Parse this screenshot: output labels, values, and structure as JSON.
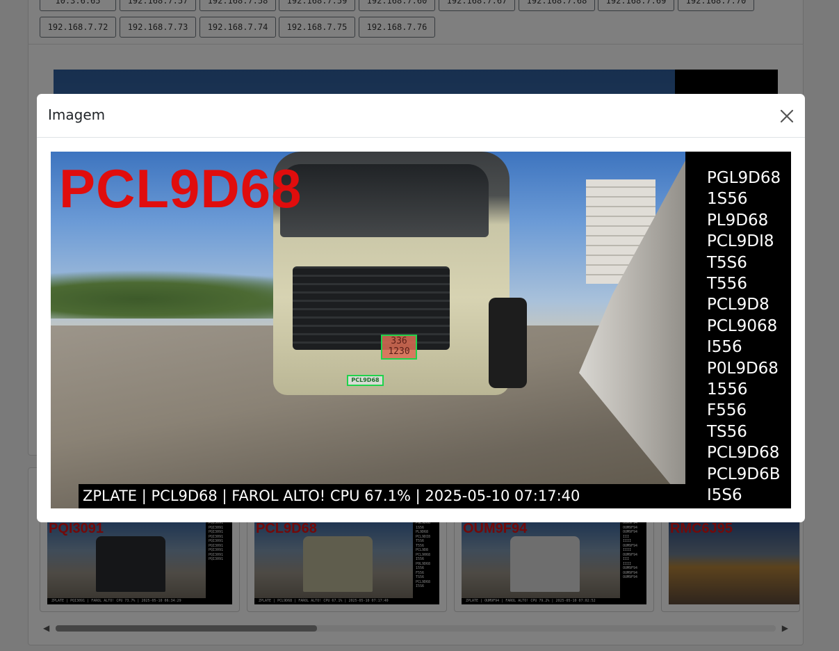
{
  "background": {
    "ip_buttons_row1": [
      "10.3.6.65",
      "192.168.7.57",
      "192.168.7.58",
      "192.168.7.59",
      "192.168.7.60",
      "192.168.7.67",
      "192.168.7.68",
      "192.168.7.69",
      "192.168.7.70"
    ],
    "ip_buttons_row2": [
      "192.168.7.72",
      "192.168.7.73",
      "192.168.7.74",
      "192.168.7.75",
      "192.168.7.76"
    ],
    "thumbnails": [
      {
        "plate": "PQI3091",
        "list": [
          "PQI3091",
          "PQI3091",
          "PQI3091",
          "PQI3091",
          "PQI3091",
          "PQI3091",
          "PQI3091",
          "PQI3091",
          "PQI3091"
        ],
        "footer": "ZPLATE | PQI3091 | FAROL ALTO! CPU 73.7% | 2025-05-10 06:34:29"
      },
      {
        "plate": "PCL9D68",
        "list": [
          "PGL9D68",
          "1S56",
          "PL9D68",
          "PCL9DI8",
          "T5S6",
          "T556",
          "PCL9D8",
          "PCL9068",
          "I556",
          "P0L9D68",
          "1556",
          "F556",
          "TS56",
          "PCL9D68",
          "I5S6"
        ],
        "footer": "ZPLATE | PCL9D68 | FAROL ALTO! CPU 67.1% | 2025-05-10 07:17:40"
      },
      {
        "plate": "OUM9F94",
        "list": [
          "OUM9F94",
          "OUM9F94",
          "OUM9F94",
          "III",
          "IIII",
          "OUM9F94",
          "IIII",
          "OUM9F94",
          "III",
          "IIII",
          "OUM9F94",
          "OUM9F94",
          "OUM9F94"
        ],
        "footer": "ZPLATE | OUM9F94 | FAROL ALTO! CPU 79.2% | 2025-05-10 07:02:52"
      },
      {
        "plate": "RMC6J95",
        "list": [],
        "footer": ""
      }
    ]
  },
  "modal": {
    "title": "Imagem",
    "close_label": "Close",
    "image": {
      "plate_overlay": "PCL9D68",
      "hazard_code_top": "336",
      "hazard_code_bottom": "1230",
      "detected_plate": "PCL9D68",
      "candidates": [
        "PGL9D68",
        "1S56",
        "PL9D68",
        "PCL9DI8",
        "T5S6",
        "T556",
        "PCL9D8",
        "PCL9068",
        "I556",
        "P0L9D68",
        "1556",
        "F556",
        "TS56",
        "PCL9D68",
        "PCL9D6B",
        "I5S6"
      ],
      "footer": "ZPLATE | PCL9D68 | FAROL ALTO! CPU 67.1% | 2025-05-10 07:17:40"
    }
  },
  "colors": {
    "plate_red": "#e00d0d",
    "detection_green": "#21d14a",
    "backdrop": "rgba(0,0,0,0.5)"
  }
}
